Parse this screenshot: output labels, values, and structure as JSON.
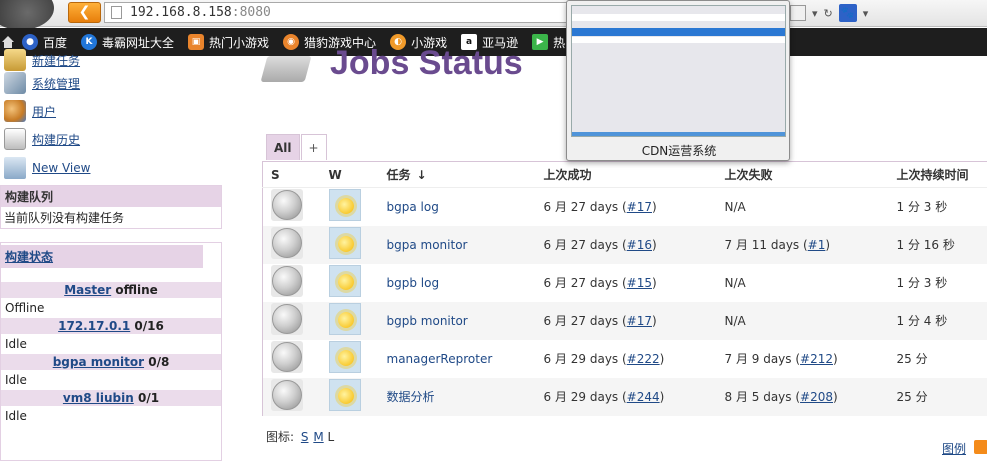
{
  "browser": {
    "url_host": "192.168.8.158",
    "url_port": ":8080",
    "bookmarks": [
      {
        "label": "百度",
        "color": "#2d62c7",
        "glyph": "🐾"
      },
      {
        "label": "毒霸网址大全",
        "color": "#2176d8",
        "glyph": "K"
      },
      {
        "label": "热门小游戏",
        "color": "#e9842c",
        "glyph": "▣"
      },
      {
        "label": "猎豹游戏中心",
        "color": "#e9842c",
        "glyph": "◉"
      },
      {
        "label": "小游戏",
        "color": "#f09a2a",
        "glyph": "◐"
      },
      {
        "label": "亚马逊",
        "color": "#ffffff",
        "glyph": "a"
      },
      {
        "label": "热",
        "color": "#3bb54a",
        "glyph": "▶"
      }
    ]
  },
  "sidebar": {
    "tasks": [
      {
        "label": "新建任务",
        "icon": "new-job-icon"
      },
      {
        "label": "系统管理",
        "icon": "manage-tools-icon"
      },
      {
        "label": "用户",
        "icon": "users-icon"
      },
      {
        "label": "构建历史",
        "icon": "build-history-icon"
      },
      {
        "label": "New View",
        "icon": "folder-icon"
      }
    ],
    "queue": {
      "title": "构建队列",
      "empty_text": "当前队列没有构建任务"
    },
    "executors": {
      "title": "构建状态",
      "nodes": [
        {
          "name": "Master",
          "suffix": " offline",
          "state": "Offline"
        },
        {
          "name": "172.17.0.1",
          "suffix": " 0/16",
          "state": "Idle"
        },
        {
          "name": "bgpa monitor",
          "suffix": " 0/8",
          "state": "Idle"
        },
        {
          "name": "vm8 liubin",
          "suffix": " 0/1",
          "state": "Idle"
        }
      ]
    }
  },
  "main": {
    "title": "Jobs Status",
    "tabs": {
      "all": "All",
      "add": "+"
    },
    "columns": {
      "s": "S",
      "w": "W",
      "job": "任务",
      "sort": "↓",
      "last_success": "上次成功",
      "last_failure": "上次失败",
      "last_duration": "上次持续时间"
    },
    "jobs": [
      {
        "name": "bgpa log",
        "ls_text": "6 月 27 days (",
        "ls_build": "#17",
        "lf_text": "N/A",
        "lf_build": "",
        "duration": "1 分 3 秒"
      },
      {
        "name": "bgpa monitor",
        "ls_text": "6 月 27 days (",
        "ls_build": "#16",
        "lf_text": "7 月 11 days (",
        "lf_build": "#1",
        "duration": "1 分 16 秒"
      },
      {
        "name": "bgpb log",
        "ls_text": "6 月 27 days (",
        "ls_build": "#15",
        "lf_text": "N/A",
        "lf_build": "",
        "duration": "1 分 3 秒"
      },
      {
        "name": "bgpb monitor",
        "ls_text": "6 月 27 days (",
        "ls_build": "#17",
        "lf_text": "N/A",
        "lf_build": "",
        "duration": "1 分 4 秒"
      },
      {
        "name": "managerReproter",
        "ls_text": "6 月 29 days (",
        "ls_build": "#222",
        "lf_text": "7 月 9 days (",
        "lf_build": "#212",
        "duration": "25 分"
      },
      {
        "name": "数据分析",
        "ls_text": "6 月 29 days (",
        "ls_build": "#244",
        "lf_text": "8 月 5 days (",
        "lf_build": "#208",
        "duration": "25 分"
      }
    ],
    "legend": {
      "label": "图标:",
      "s": "S",
      "m": "M",
      "l": "L"
    },
    "icon_legend": "图例"
  },
  "thumbnail": {
    "label": "CDN运营系统"
  }
}
